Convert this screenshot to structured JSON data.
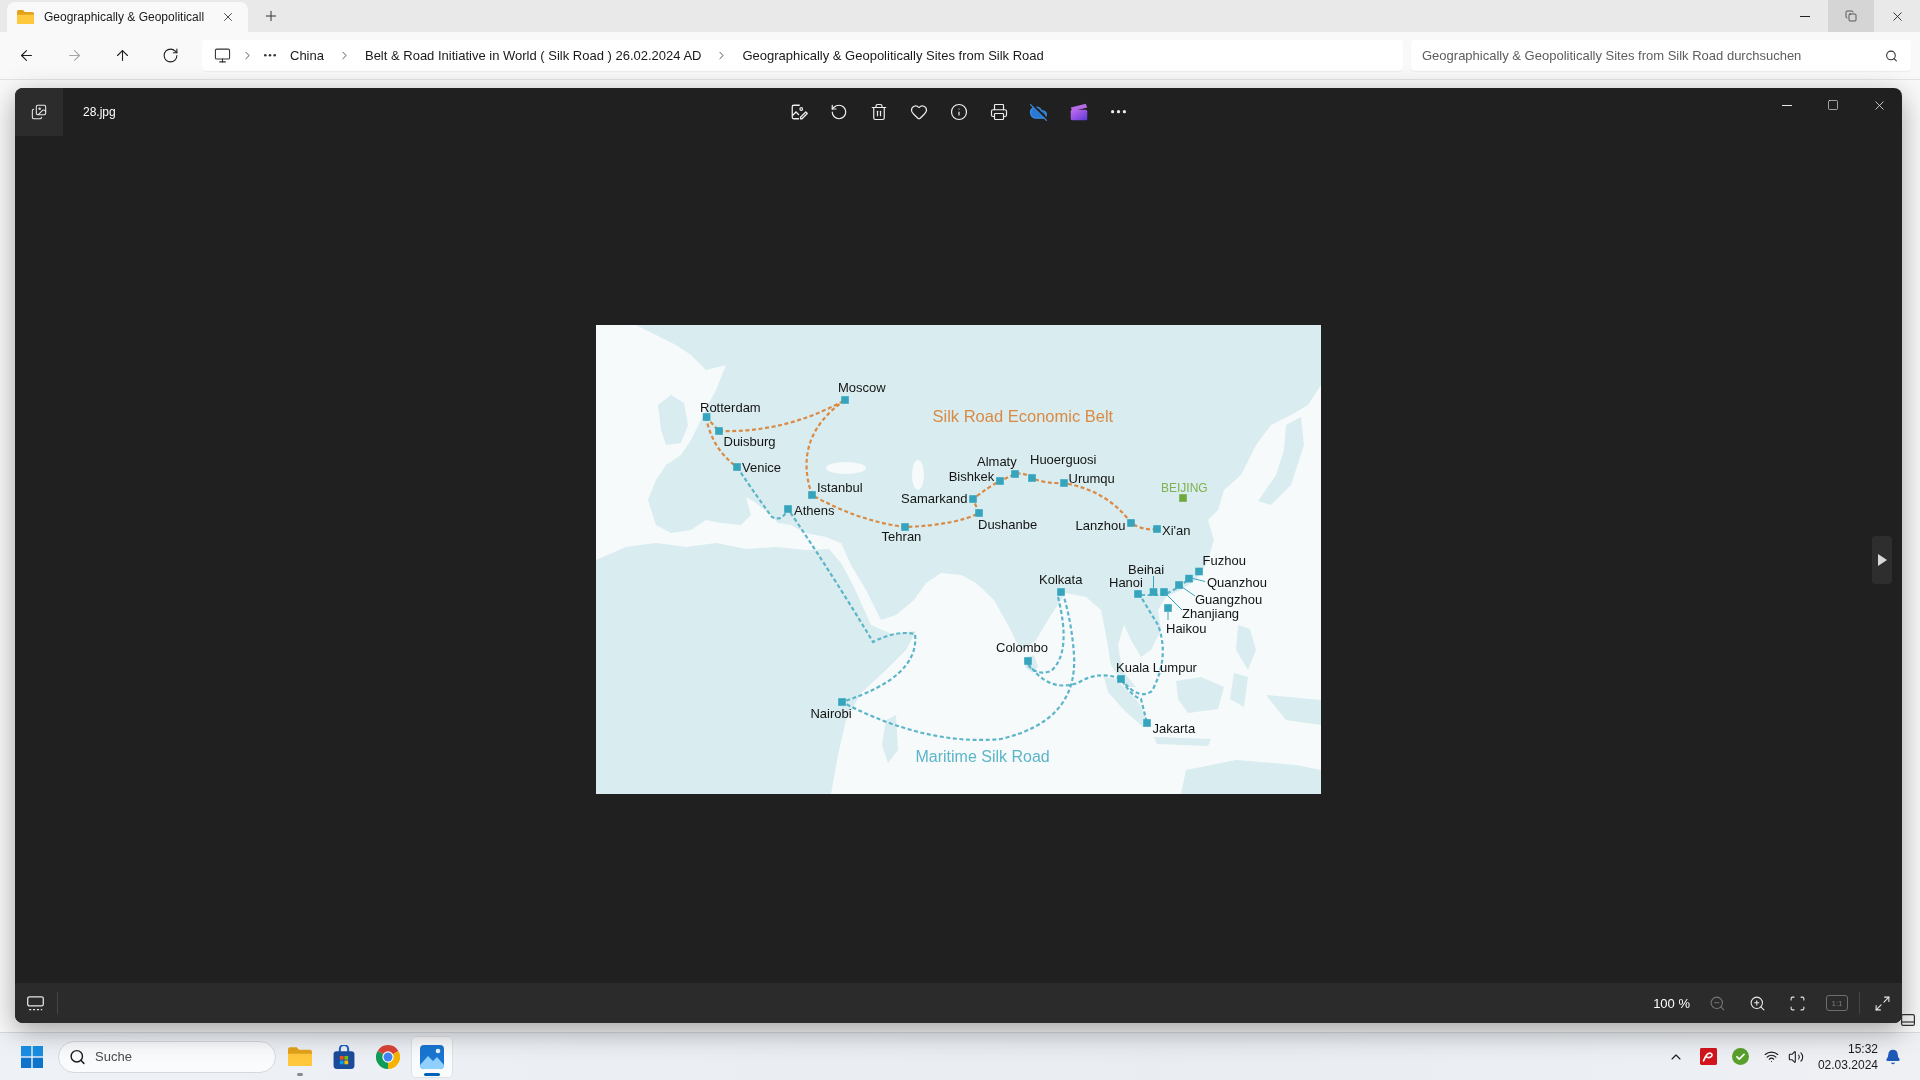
{
  "explorer": {
    "tabs": [
      {
        "title": "Geographically & Geopoliticall",
        "selected": true
      }
    ],
    "window_controls": [
      {
        "kind": "minimize",
        "hovered": false
      },
      {
        "kind": "restore",
        "hovered": true
      },
      {
        "kind": "close",
        "hovered": false
      }
    ],
    "nav": [
      {
        "kind": "back",
        "disabled": false
      },
      {
        "kind": "forward",
        "disabled": true
      },
      {
        "kind": "up",
        "disabled": false
      },
      {
        "kind": "refresh",
        "disabled": false
      }
    ],
    "breadcrumbs": [
      "China",
      "Belt & Road Initiative in World ( Silk Road ) 26.02.2024 AD",
      "Geographically & Geopolitically Sites from Silk Road"
    ],
    "search": {
      "placeholder": "Geographically & Geopolitically Sites from Silk Road durchsuchen"
    }
  },
  "viewer": {
    "file_name": "28.jpg",
    "zoom": "100 %",
    "zoom_controls": [
      {
        "kind": "zoom_out",
        "disabled": true
      },
      {
        "kind": "zoom_in",
        "disabled": false
      },
      {
        "kind": "fit",
        "disabled": false
      },
      {
        "kind": "actual_size",
        "label": "1:1",
        "disabled": true
      },
      {
        "kind": "fullscreen",
        "disabled": false
      }
    ]
  },
  "map": {
    "routes": [
      {
        "name": "Silk Road Economic Belt",
        "kind": "land",
        "color": "#d98a45"
      },
      {
        "name": "Maritime Silk Road",
        "kind": "sea",
        "color": "#5cb5c8"
      }
    ],
    "cities": [
      {
        "name": "Moscow",
        "kind": "stop"
      },
      {
        "name": "Rotterdam",
        "kind": "stop"
      },
      {
        "name": "Duisburg",
        "kind": "stop"
      },
      {
        "name": "Venice",
        "kind": "stop"
      },
      {
        "name": "Istanbul",
        "kind": "stop"
      },
      {
        "name": "Athens",
        "kind": "stop"
      },
      {
        "name": "Almaty",
        "kind": "stop"
      },
      {
        "name": "Huoerguosi",
        "kind": "stop"
      },
      {
        "name": "Bishkek",
        "kind": "stop"
      },
      {
        "name": "Urumqu",
        "kind": "stop"
      },
      {
        "name": "Samarkand",
        "kind": "stop"
      },
      {
        "name": "Tehran",
        "kind": "stop"
      },
      {
        "name": "Dushanbe",
        "kind": "stop"
      },
      {
        "name": "Lanzhou",
        "kind": "stop"
      },
      {
        "name": "BEIJING",
        "kind": "capital"
      },
      {
        "name": "Xi'an",
        "kind": "stop"
      },
      {
        "name": "Kolkata",
        "kind": "stop"
      },
      {
        "name": "Fuzhou",
        "kind": "stop"
      },
      {
        "name": "Beihai",
        "kind": "stop"
      },
      {
        "name": "Hanoi",
        "kind": "stop"
      },
      {
        "name": "Quanzhou",
        "kind": "stop"
      },
      {
        "name": "Guangzhou",
        "kind": "stop"
      },
      {
        "name": "Zhanjiang",
        "kind": "stop"
      },
      {
        "name": "Haikou",
        "kind": "stop"
      },
      {
        "name": "Colombo",
        "kind": "stop"
      },
      {
        "name": "Kuala Lumpur",
        "kind": "stop"
      },
      {
        "name": "Jakarta",
        "kind": "stop"
      },
      {
        "name": "Nairobi",
        "kind": "stop"
      }
    ]
  },
  "taskbar": {
    "search": {
      "placeholder": "Suche"
    },
    "apps": [
      {
        "kind": "file_explorer",
        "running": true,
        "selected": false
      },
      {
        "kind": "store",
        "running": false,
        "selected": false
      },
      {
        "kind": "browser",
        "running": false,
        "selected": false
      },
      {
        "kind": "photos",
        "running": true,
        "selected": true
      }
    ],
    "time": "15:32",
    "date": "02.03.2024"
  }
}
